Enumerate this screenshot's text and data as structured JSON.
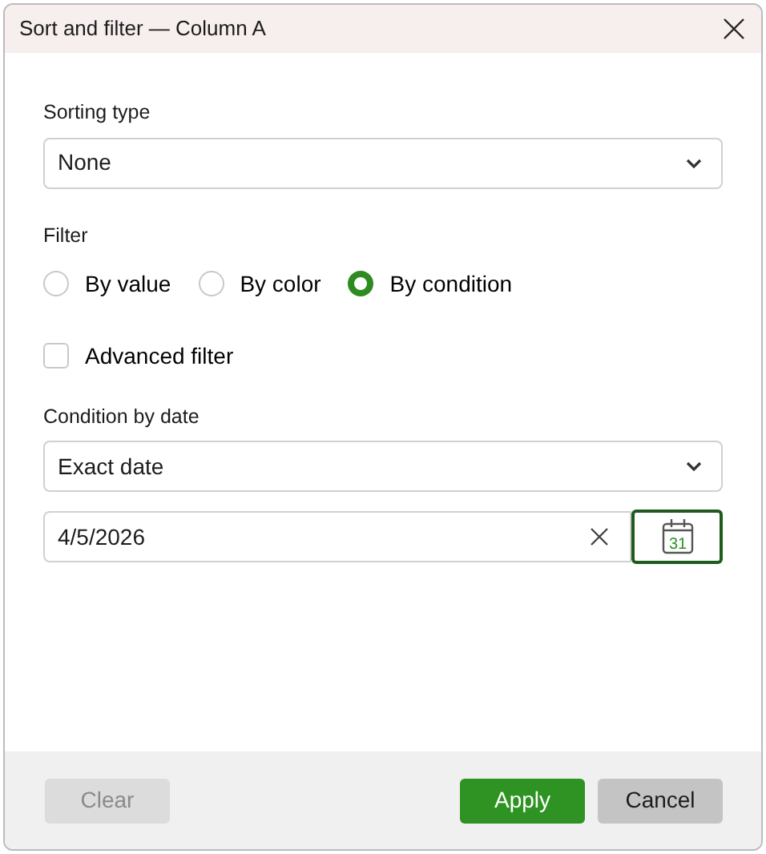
{
  "window": {
    "title": "Sort and filter — Column A"
  },
  "sorting": {
    "label": "Sorting type",
    "value": "None"
  },
  "filter": {
    "label": "Filter",
    "options": [
      {
        "label": "By value",
        "selected": false
      },
      {
        "label": "By color",
        "selected": false
      },
      {
        "label": "By condition",
        "selected": true
      }
    ]
  },
  "advanced_filter": {
    "label": "Advanced filter",
    "checked": false
  },
  "condition": {
    "label": "Condition by date",
    "value": "Exact date"
  },
  "date_field": {
    "value": "4/5/2026",
    "calendar_day": "31"
  },
  "buttons": [
    {
      "label": "Clear",
      "kind": "secondary",
      "disabled": true
    },
    {
      "label": "Apply",
      "kind": "primary",
      "disabled": false
    },
    {
      "label": "Cancel",
      "kind": "secondary",
      "disabled": false
    }
  ]
}
